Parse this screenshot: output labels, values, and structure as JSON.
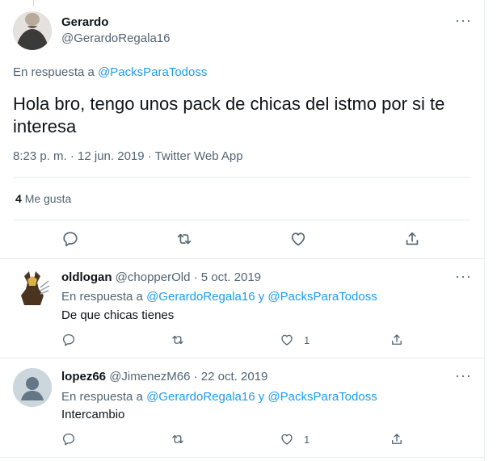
{
  "main_tweet": {
    "author_name": "Gerardo",
    "author_handle": "@GerardoRegala16",
    "reply_prefix": "En respuesta a",
    "reply_to": "@PacksParaTodoss",
    "text": "Hola bro, tengo unos pack de chicas del istmo por si te interesa",
    "meta": "8:23 p. m. · 12 jun. 2019 · Twitter Web App",
    "likes_count": "4",
    "likes_label": "Me gusta",
    "more_icon": "more-horizontal-icon"
  },
  "replies": [
    {
      "author_name": "oldlogan",
      "author_handle": "@chopperOld",
      "date": "· 5 oct. 2019",
      "reply_prefix": "En respuesta a",
      "reply_to_1": "@GerardoRegala16",
      "reply_joiner": "y",
      "reply_to_2": "@PacksParaTodoss",
      "text": "De que chicas tienes",
      "like_count": "1"
    },
    {
      "author_name": "lopez66",
      "author_handle": "@JimenezM66",
      "date": "· 22 oct. 2019",
      "reply_prefix": "En respuesta a",
      "reply_to_1": "@GerardoRegala16",
      "reply_joiner": "y",
      "reply_to_2": "@PacksParaTodoss",
      "text": "Intercambio",
      "like_count": "1"
    }
  ],
  "colors": {
    "accent": "#1d9bf0",
    "text": "#0f1419",
    "muted": "#536471",
    "divider": "#e6ecf0"
  }
}
